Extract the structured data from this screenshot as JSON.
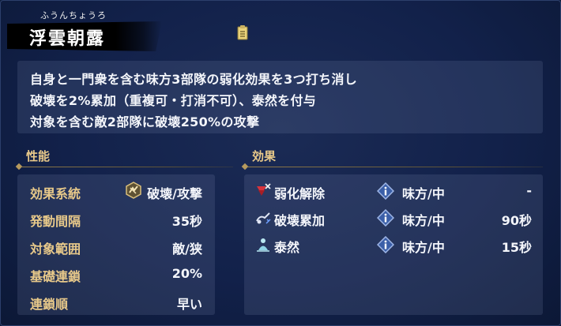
{
  "skill": {
    "ruby": "ふうんちょうろ",
    "name": "浮雲朝露"
  },
  "description": [
    "自身と一門衆を含む味方3部隊の弱化効果を3つ打ち消し",
    "破壊を2%累加（重複可・打消不可）、泰然を付与",
    "対象を含む敵2部隊に破壊250%の攻撃"
  ],
  "performance": {
    "header": "性能",
    "rows": [
      {
        "label": "効果系統",
        "value": "破壊/攻撃",
        "icon": "strike-type-icon"
      },
      {
        "label": "発動間隔",
        "value": "35秒"
      },
      {
        "label": "対象範囲",
        "value": "敵/狭"
      },
      {
        "label": "基礎連鎖",
        "value": "20%"
      },
      {
        "label": "連鎖順",
        "value": "早い"
      }
    ]
  },
  "effects": {
    "header": "効果",
    "rows": [
      {
        "name": "弱化解除",
        "icon": "debuff-cleanse-icon",
        "target": "味方/中",
        "duration": "-"
      },
      {
        "name": "破壊累加",
        "icon": "destruction-stack-icon",
        "target": "味方/中",
        "duration": "90秒"
      },
      {
        "name": "泰然",
        "icon": "composure-icon",
        "target": "味方/中",
        "duration": "15秒"
      }
    ]
  },
  "colors": {
    "accent_gold": "#e8c98a",
    "background": "#12214a",
    "text": "#f4f6fb"
  }
}
